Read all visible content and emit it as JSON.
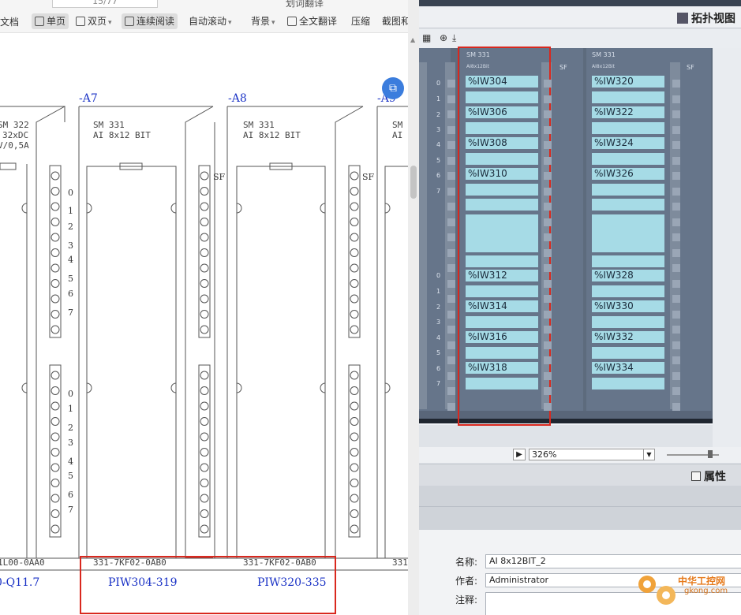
{
  "reader": {
    "toolbar": {
      "docs_label": "文档",
      "single_page": "单页",
      "double_page": "双页",
      "continuous": "连续阅读",
      "auto_scroll": "自动滚动",
      "background": "背景",
      "translate_page": "划词翻译",
      "full_translate": "全文翻译",
      "compress": "压缩",
      "screenshot": "截图和",
      "page_indicator": "15/77"
    },
    "schematic": {
      "slots": [
        "-A7",
        "-A8",
        "-A9"
      ],
      "left_module": {
        "line1": "SM 322",
        "line2": "32xDC",
        "line3": "V/0,5A",
        "order": "1L00-0AA0",
        "range": "0-Q11.7"
      },
      "a7_module": {
        "line1": "SM 331",
        "line2": "AI 8x12 BIT",
        "order": "331-7KF02-0AB0",
        "range": "PIW304-319"
      },
      "a8_module": {
        "line1": "SM 331",
        "line2": "AI 8x12 BIT",
        "order": "331-7KF02-0AB0",
        "range": "PIW320-335"
      },
      "a9_module": {
        "line1": "SM",
        "line2": "AI",
        "order": "331"
      },
      "sf_label": "SF",
      "channel_numbers_top": [
        "0",
        "1",
        "2",
        "3",
        "4",
        "5",
        "6",
        "7"
      ],
      "channel_numbers_bottom": [
        "0",
        "1",
        "2",
        "3",
        "4",
        "5",
        "6",
        "7"
      ]
    }
  },
  "tia": {
    "tab_title": "拓扑视图",
    "module_a": {
      "head1": "SM 331",
      "head2": "AI8x12Bit",
      "addresses_top": [
        "%IW304",
        "%IW306",
        "%IW308",
        "%IW310"
      ],
      "addresses_bottom": [
        "%IW312",
        "%IW314",
        "%IW316",
        "%IW318"
      ]
    },
    "module_b": {
      "head1": "SM 331",
      "head2": "AI8x12Bit",
      "addresses_top": [
        "%IW320",
        "%IW322",
        "%IW324",
        "%IW326"
      ],
      "addresses_bottom": [
        "%IW328",
        "%IW330",
        "%IW332",
        "%IW334"
      ]
    },
    "sf_label": "SF",
    "channel_numbers": [
      "0",
      "1",
      "2",
      "3",
      "4",
      "5",
      "6",
      "7"
    ],
    "zoom": "326%",
    "properties_title": "属性",
    "form": {
      "name_label": "名称:",
      "name_value": "AI 8x12BIT_2",
      "author_label": "作者:",
      "author_value": "Administrator",
      "comment_label": "注释:"
    },
    "watermark": {
      "line1": "中华工控网",
      "line2": "gkong.com"
    }
  },
  "colors": {
    "highlight": "#d9281e",
    "schematic_blue": "#1b33c6",
    "module_bg": "#66758a",
    "channel_fill": "#a6dbe6"
  }
}
